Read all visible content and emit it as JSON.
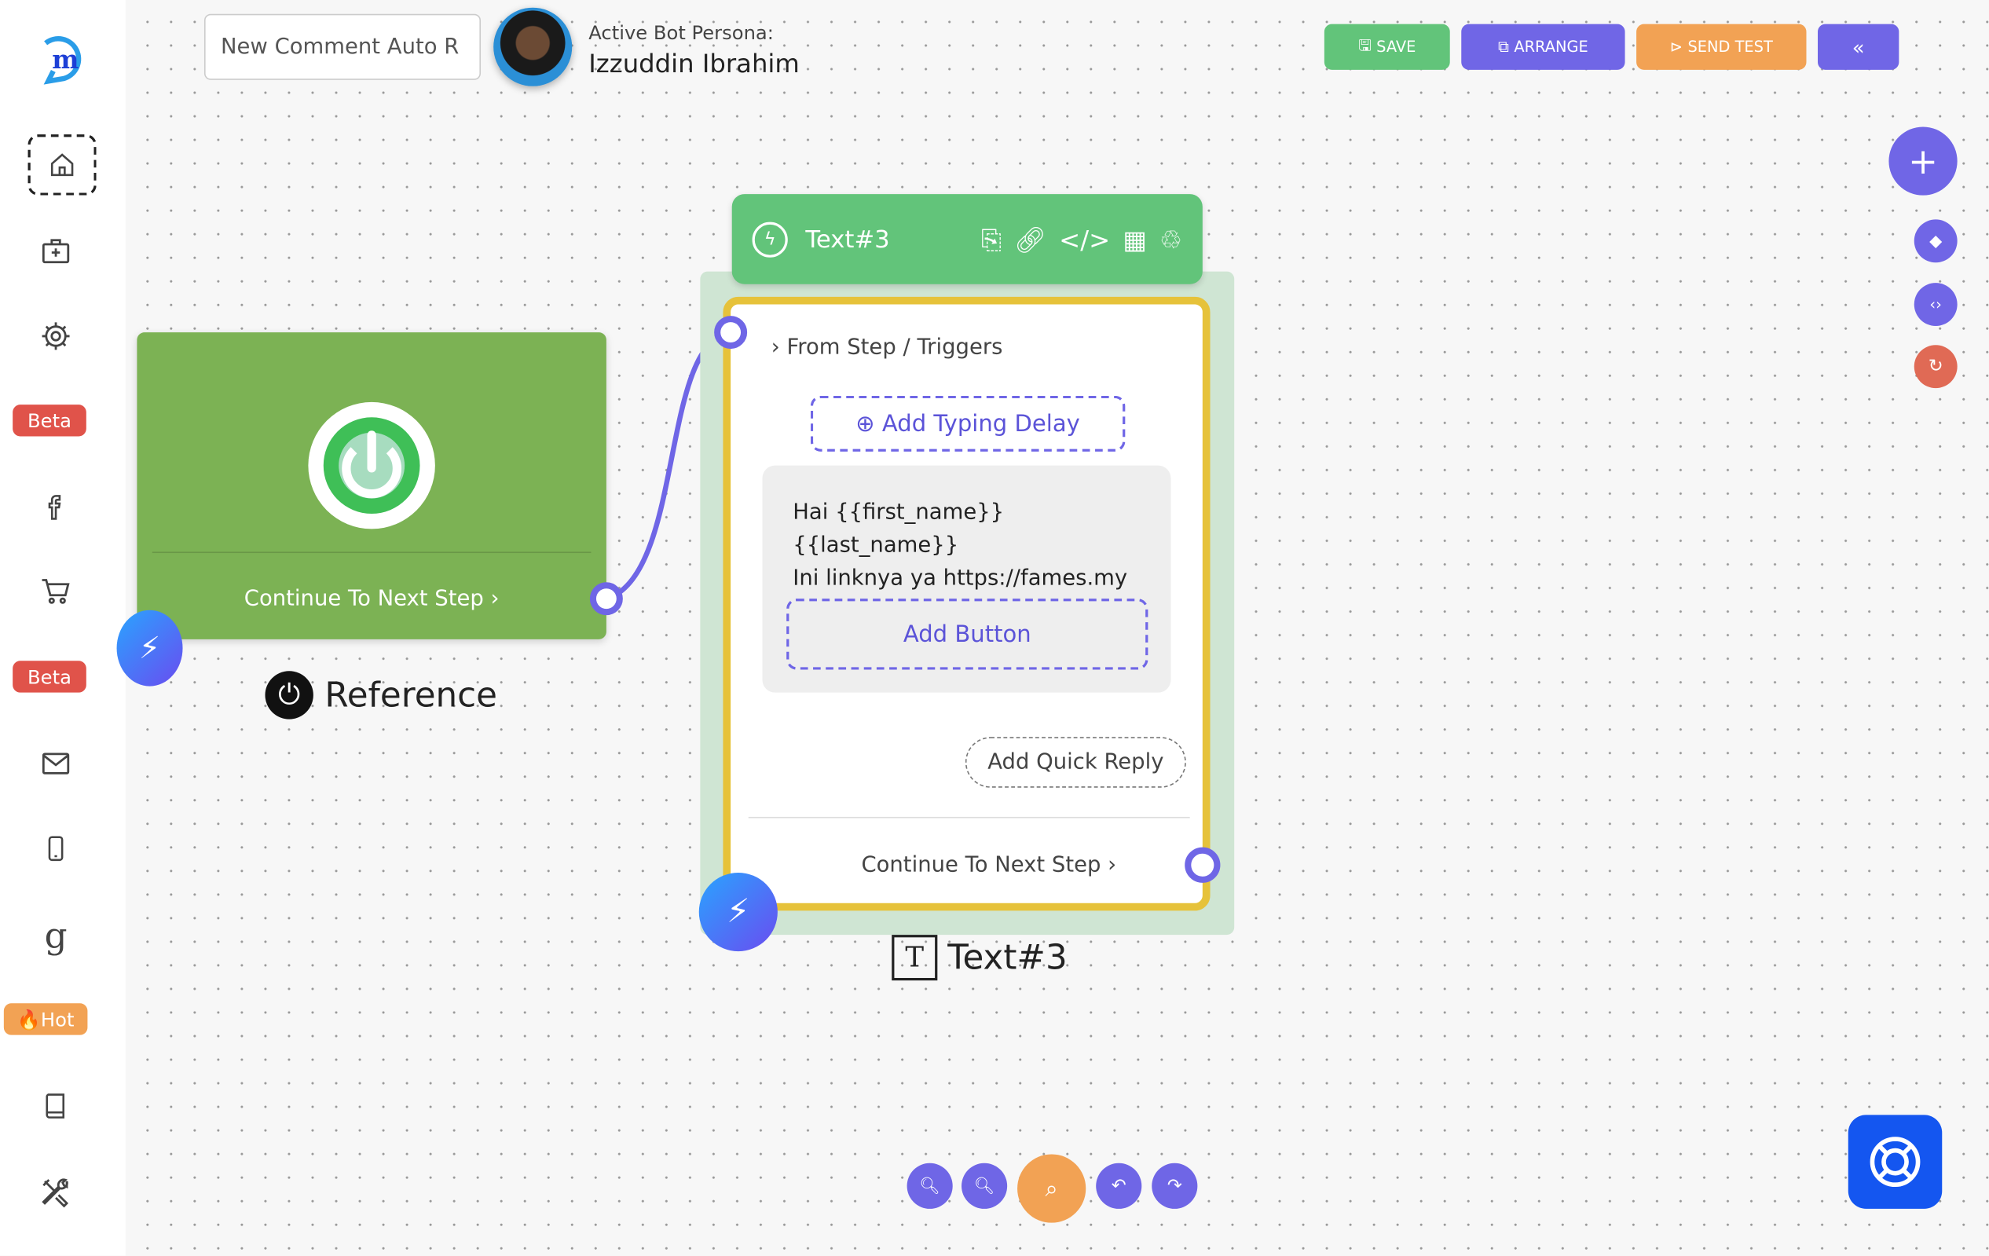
{
  "header": {
    "flow_name_value": "New Comment Auto R",
    "persona_label": "Active Bot Persona:",
    "persona_name": "Izzuddin Ibrahim",
    "buttons": {
      "save": "SAVE",
      "arrange": "ARRANGE",
      "send_test": "SEND TEST"
    }
  },
  "sidebar": {
    "items": [
      "home-icon",
      "briefcase-plus-icon",
      "gear-icon",
      "facebook-icon",
      "cart-icon",
      "mail-icon",
      "mobile-icon",
      "google-icon",
      "book-icon",
      "tools-icon"
    ],
    "badges": {
      "beta1": "Beta",
      "beta2": "Beta",
      "hot": "🔥Hot"
    }
  },
  "nodes": {
    "reference": {
      "continue_label": "Continue To Next Step",
      "title": "Reference",
      "color": "#7cb254"
    },
    "text3": {
      "header_title": "Text#3",
      "from_label": "From Step / Triggers",
      "add_typing_delay": "Add Typing Delay",
      "message_line1": "Hai {{first_name}} {{last_name}}",
      "message_line2": "Ini linknya ya https://fames.my",
      "add_button": "Add Button",
      "add_quick_reply": "Add Quick Reply",
      "continue_label": "Continue To Next Step",
      "title": "Text#3",
      "header_color": "#62c47a",
      "border_color": "#e6c23a"
    }
  },
  "colors": {
    "primary": "#6f66e6",
    "save": "#62c47a",
    "send_test": "#f2a254",
    "danger": "#e06a55",
    "help": "#1456f0"
  }
}
